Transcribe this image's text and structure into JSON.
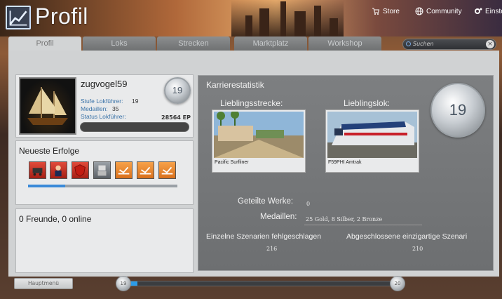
{
  "header": {
    "title": "Profil",
    "nav": [
      {
        "label": "Store"
      },
      {
        "label": "Community"
      },
      {
        "label": "Einstel"
      }
    ]
  },
  "tabs": [
    {
      "label": "Profil",
      "active": true
    },
    {
      "label": "Loks",
      "active": false
    },
    {
      "label": "Strecken",
      "active": false
    },
    {
      "label": "Marktplatz",
      "active": false
    },
    {
      "label": "Workshop",
      "active": false
    }
  ],
  "search": {
    "placeholder": "Suchen",
    "clear_label": "×"
  },
  "profile": {
    "username": "zugvogel59",
    "level": "19",
    "stats": [
      {
        "label": "Stufe Lokführer:",
        "value": "19"
      },
      {
        "label": "Medaillen:",
        "value": "35"
      },
      {
        "label": "Status Lokführer:",
        "value": ""
      }
    ],
    "xp": "28564 EP"
  },
  "achievements": {
    "title": "Neueste Erfolge",
    "items": [
      {
        "icon": "coal-wagon-icon",
        "color": "red"
      },
      {
        "icon": "conductor-icon",
        "color": "red"
      },
      {
        "icon": "shield-icon",
        "color": "red"
      },
      {
        "icon": "robot-icon",
        "color": "grey"
      },
      {
        "icon": "track-icon",
        "color": "orange"
      },
      {
        "icon": "track-icon",
        "color": "orange"
      },
      {
        "icon": "track-icon",
        "color": "orange"
      }
    ],
    "progress": 0.25
  },
  "friends": {
    "text": "0 Freunde, 0 online"
  },
  "career": {
    "title": "Karrierestatistik",
    "level": "19",
    "favorite_route": {
      "label": "Lieblingsstrecke:",
      "caption": "Pacific Surfliner"
    },
    "favorite_loco": {
      "label": "Lieblingslok:",
      "caption": "F59PHI Amtrak"
    },
    "shared_works": {
      "label": "Geteilte Werke:",
      "value": "0"
    },
    "medals": {
      "label": "Medaillen:",
      "value": "25 Gold, 8 Silber, 2 Bronze"
    },
    "failed": {
      "label": "Einzelne Szenarien fehlgeschlagen",
      "value": "216"
    },
    "completed": {
      "label": "Abgeschlossene einzigartige Szenari",
      "value": "210"
    }
  },
  "footer": {
    "main_menu": "Hauptmenü",
    "level_from": "19",
    "level_to": "20",
    "level_progress": 0.05
  },
  "colors": {
    "accent": "#2c9ce8",
    "panel_dark": "#76787a",
    "panel_light": "#e9eaeb"
  }
}
